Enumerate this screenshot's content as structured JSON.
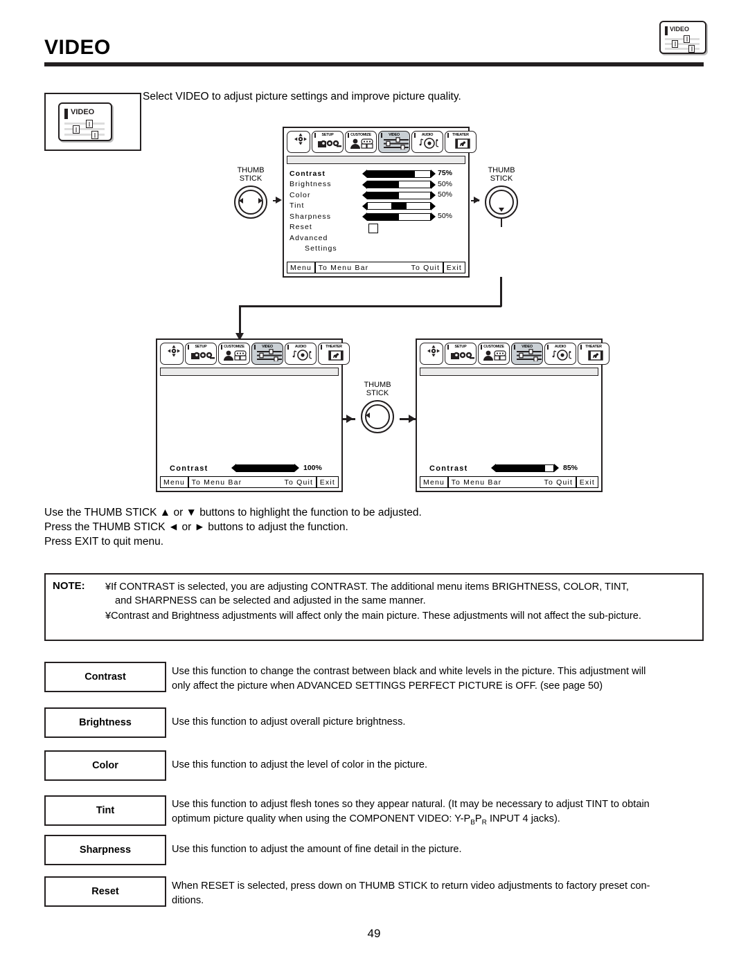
{
  "page": {
    "title": "VIDEO",
    "number": "49",
    "intro": "Select VIDEO to adjust picture settings and improve picture quality."
  },
  "badge": {
    "label": "VIDEO",
    "icon": "video-sliders-icon"
  },
  "menu_bar": {
    "tabs": [
      {
        "label": "",
        "icon": "home-dpad-icon",
        "selected": false
      },
      {
        "label": "SETUP",
        "icon": "camcorder-icon",
        "selected": false
      },
      {
        "label": "CUSTOMIZE",
        "icon": "person-tv-icon",
        "selected": false
      },
      {
        "label": "VIDEO",
        "icon": "video-sliders-icon",
        "selected": true
      },
      {
        "label": "AUDIO",
        "icon": "speaker-notes-icon",
        "selected": false
      },
      {
        "label": "THEATER",
        "icon": "film-horse-icon",
        "selected": false
      }
    ]
  },
  "osd_main": {
    "rows": [
      {
        "label": "Contrast",
        "bold": true,
        "type": "slider",
        "value": 75,
        "percent": "75%"
      },
      {
        "label": "Brightness",
        "bold": false,
        "type": "slider",
        "value": 50,
        "percent": "50%"
      },
      {
        "label": "Color",
        "bold": false,
        "type": "slider",
        "value": 50,
        "percent": "50%"
      },
      {
        "label": "Tint",
        "bold": false,
        "type": "centered",
        "value": 50,
        "percent": ""
      },
      {
        "label": "Sharpness",
        "bold": false,
        "type": "slider",
        "value": 50,
        "percent": "50%"
      },
      {
        "label": "Reset",
        "bold": false,
        "type": "checkbox",
        "value": 0,
        "percent": ""
      },
      {
        "label": "Advanced",
        "bold": false,
        "type": "text",
        "value": 0,
        "percent": ""
      },
      {
        "label": "Settings",
        "bold": false,
        "type": "indent",
        "value": 0,
        "percent": ""
      }
    ],
    "footer": {
      "menu": "Menu",
      "to_menu_bar": "To Menu Bar",
      "to_quit": "To Quit",
      "exit": "Exit"
    }
  },
  "osd_left": {
    "row": {
      "label": "Contrast",
      "value": 100,
      "percent": "100%"
    },
    "footer": {
      "menu": "Menu",
      "to_menu_bar": "To Menu Bar",
      "to_quit": "To Quit",
      "exit": "Exit"
    }
  },
  "osd_right": {
    "row": {
      "label": "Contrast",
      "value": 85,
      "percent": "85%"
    },
    "footer": {
      "menu": "Menu",
      "to_menu_bar": "To Menu Bar",
      "to_quit": "To Quit",
      "exit": "Exit"
    }
  },
  "thumb_sticks": {
    "label_line1": "THUMB",
    "label_line2": "STICK"
  },
  "instructions": {
    "line1": "Use the THUMB STICK ▲ or ▼ buttons to highlight the function to be adjusted.",
    "line2": "Press the THUMB STICK ◄ or ► buttons to adjust the function.",
    "line3": "Press EXIT to quit menu."
  },
  "note": {
    "label": "NOTE:",
    "lines": [
      "¥If CONTRAST is selected, you are adjusting CONTRAST.  The additional menu items BRIGHTNESS, COLOR, TINT,",
      "and SHARPNESS can be selected and adjusted in the same manner.",
      "¥Contrast and Brightness adjustments will affect only the main picture. These adjustments will not affect the sub-picture."
    ]
  },
  "functions": [
    {
      "name": "Contrast",
      "line1": "Use this function to change the contrast between black and white levels in the picture.  This adjustment will",
      "line2": "only affect the picture when ADVANCED SETTINGS PERFECT PICTURE is OFF. (see page 50)"
    },
    {
      "name": "Brightness",
      "line1": "Use this function to adjust overall picture brightness.",
      "line2": ""
    },
    {
      "name": "Color",
      "line1": "Use this function to adjust the level of color in the picture.",
      "line2": ""
    },
    {
      "name": "Tint",
      "line1": "Use this function to adjust flesh tones so they appear natural. (It may be necessary to adjust TINT to obtain",
      "line2": "optimum picture quality when using the COMPONENT VIDEO: Y-PBPR INPUT 4 jacks)."
    },
    {
      "name": "Sharpness",
      "line1": "Use this function to adjust the amount of fine detail in the picture.",
      "line2": ""
    },
    {
      "name": "Reset",
      "line1": "When RESET is selected, press down on THUMB STICK to return video adjustments to factory preset con-",
      "line2": "ditions."
    }
  ]
}
